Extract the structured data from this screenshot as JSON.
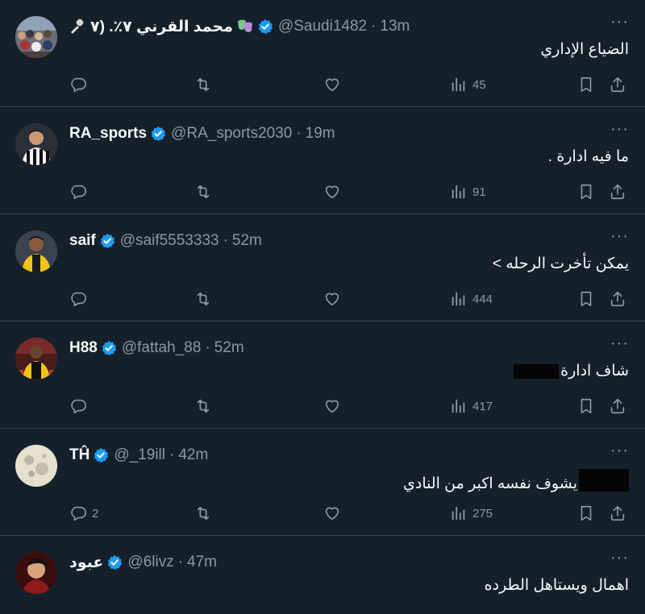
{
  "tweets": [
    {
      "name": "محمد القرني ٧٪. (٧",
      "handle": "@Saudi1482",
      "time": "13m",
      "text": "الضياع الإداري",
      "replies": "",
      "views": "45",
      "avatar": "crowd",
      "name_emojis": [
        "microphone-icon",
        "theater-masks-icon"
      ]
    },
    {
      "name": "RA_sports",
      "handle": "@RA_sports2030",
      "time": "19m",
      "text": "ما فيه ادارة .",
      "replies": "",
      "views": "91",
      "avatar": "player-stripes"
    },
    {
      "name": "saif",
      "handle": "@saif5553333",
      "time": "52m",
      "text": "يمكن تأخرت الرحله >",
      "replies": "",
      "views": "444",
      "avatar": "player-yellow"
    },
    {
      "name": "H88",
      "handle": "@fattah_88",
      "time": "52m",
      "text": "شاف ادارة",
      "replies": "",
      "views": "417",
      "avatar": "player-red"
    },
    {
      "name": "TĤ",
      "handle": "@_19ill",
      "time": "42m",
      "text": "يشوف نفسه اكبر من النادي",
      "replies": "2",
      "views": "275",
      "avatar": "moon"
    },
    {
      "name": "عبود",
      "handle": "@6livz",
      "time": "47m",
      "text": "اهمال ويستاهل الطرده",
      "replies": "",
      "views": "",
      "avatar": "person-red"
    }
  ],
  "colors": {
    "background": "#15202b",
    "divider": "#38444d",
    "muted": "#8b98a5",
    "verified": "#1d9bf0"
  },
  "icons": [
    "reply-icon",
    "retweet-icon",
    "like-icon",
    "views-icon",
    "bookmark-icon",
    "share-icon",
    "verified-badge-icon",
    "more-icon"
  ]
}
